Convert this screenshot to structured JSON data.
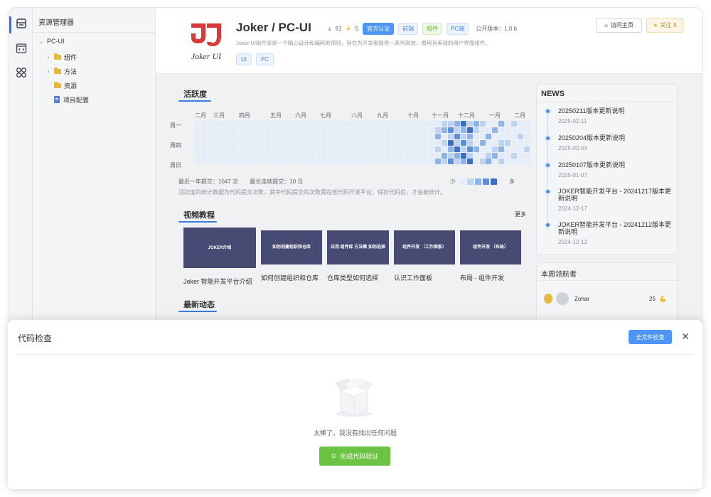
{
  "explorer": {
    "title": "资源管理器",
    "root": "PC-UI",
    "items": [
      {
        "label": "组件",
        "type": "folder"
      },
      {
        "label": "方法",
        "type": "folder"
      },
      {
        "label": "资源",
        "type": "folder"
      },
      {
        "label": "项目配置",
        "type": "file"
      }
    ]
  },
  "project": {
    "logo_text": "Joker UI",
    "title": "Joker / PC-UI",
    "downloads": "91",
    "stars": "5",
    "tags": [
      "官方认证",
      "前端",
      "组件",
      "PC端"
    ],
    "version_label": "公开版本：",
    "version": "1.0.6",
    "description": "Joker UI组件库是一个精心设计和编码的项目，旨在为开发者提供一系列高效、易用且美观的用户界面组件。",
    "chips": [
      "UI",
      "PC"
    ],
    "visit_label": "访问主页",
    "follow_label": "关注",
    "follow_count": "5"
  },
  "activity": {
    "title": "活跃度",
    "months": [
      "二月",
      "三月",
      "四月",
      "五月",
      "六月",
      "七月",
      "八月",
      "九月",
      "十月",
      "十一月",
      "十二月",
      "一月",
      "二月"
    ],
    "weekdays": [
      "周一",
      "周四",
      "周日"
    ],
    "total_label": "最近一年提交：",
    "total": "1047 次",
    "streak_label": "最长连续提交：",
    "streak": "10 日",
    "note": "活跃度的统计数据为代码提交次数，其中代码提交的次数需在低代码开发平台，保存代码后，才会被统计。",
    "legend_less": "少",
    "legend_more": "多",
    "colors": [
      "#e5edf8",
      "#bdd3f1",
      "#8db3e8",
      "#5b8fd8",
      "#3a6fc4"
    ]
  },
  "videos": {
    "title": "视频教程",
    "more": "更多",
    "items": [
      {
        "thumb": "JOKER介绍",
        "caption": "Joker 智能开发平台介绍"
      },
      {
        "thumb": "如何创建组织和仓库",
        "caption": "如何创建组织和仓库"
      },
      {
        "thumb": "应用 组件库 方法集 如何选择",
        "caption": "仓库类型如何选择"
      },
      {
        "thumb": "组件开发 （工作面板）",
        "caption": "认识工作面板"
      },
      {
        "thumb": "组件开发 （布局）",
        "caption": "布局 - 组件开发"
      }
    ]
  },
  "feed": {
    "title": "最新动态"
  },
  "news": {
    "title": "NEWS",
    "items": [
      {
        "title": "20250211版本更新说明",
        "date": "2025-02-11"
      },
      {
        "title": "20250204版本更新说明",
        "date": "2025-02-04"
      },
      {
        "title": "20250107版本更新说明",
        "date": "2025-01-07"
      },
      {
        "title": "JOKER智能开发平台 - 20241217版本更新说明",
        "date": "2024-12-17"
      },
      {
        "title": "JOKER智能开发平台 - 20241212版本更新说明",
        "date": "2024-12-12"
      }
    ]
  },
  "leaders": {
    "title": "本周领航者",
    "items": [
      {
        "name": "Zohar",
        "score": "25"
      }
    ]
  },
  "dialog": {
    "title": "代码检查",
    "check_all": "全文件检查",
    "empty_message": "太棒了，我没有找出任何问题",
    "finish": "完成代码验证"
  }
}
